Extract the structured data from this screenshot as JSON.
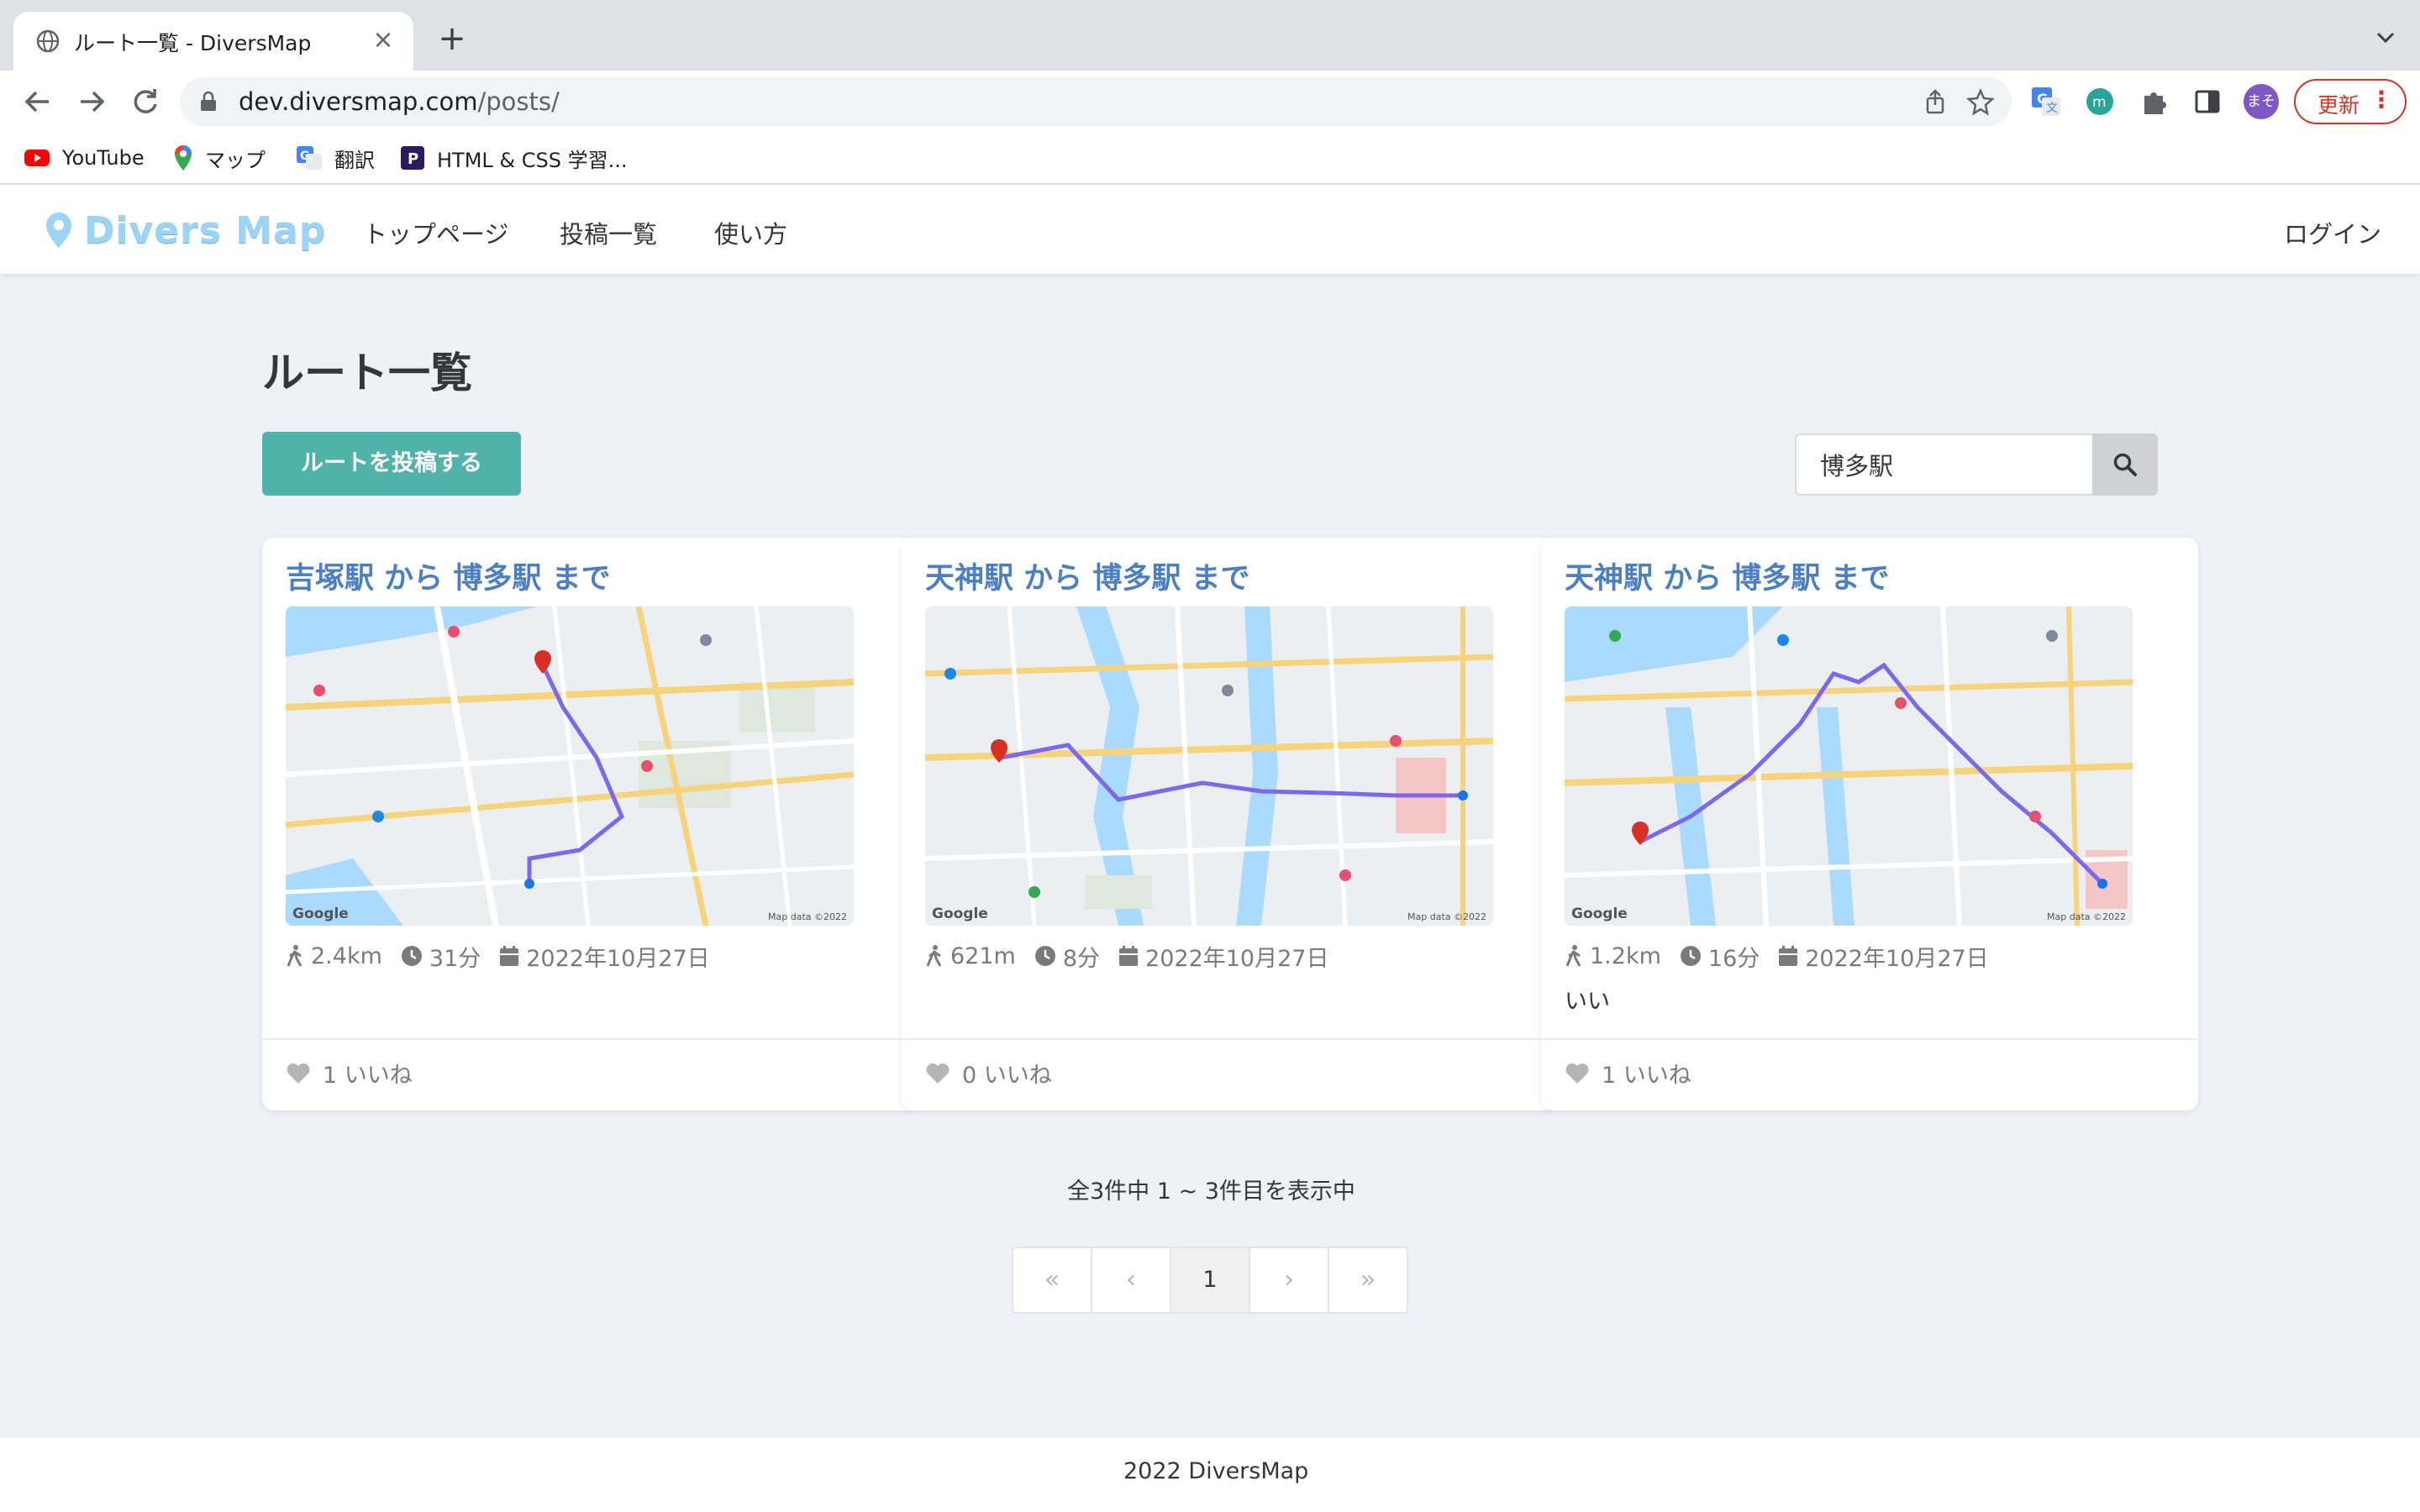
{
  "browser": {
    "tab_title": "ルート一覧 - DiversMap",
    "new_tab": "+",
    "url_host": "dev.diversmap.com",
    "url_path": "/posts/",
    "profile_initials": "まそ",
    "update_label": "更新",
    "bookmarks": [
      {
        "label": "YouTube",
        "icon": "youtube-icon"
      },
      {
        "label": "マップ",
        "icon": "maps-pin-icon"
      },
      {
        "label": "翻訳",
        "icon": "translate-icon"
      },
      {
        "label": "HTML & CSS 学習...",
        "icon": "progate-icon"
      }
    ]
  },
  "site": {
    "logo": "Divers Map",
    "nav": [
      "トップページ",
      "投稿一覧",
      "使い方"
    ],
    "login": "ログイン"
  },
  "page": {
    "title": "ルート一覧",
    "post_button": "ルートを投稿する",
    "search_value": "博多駅",
    "count_text": "全3件中 1 ~ 3件目を表示中",
    "pagination": [
      "«",
      "‹",
      "1",
      "›",
      "»"
    ],
    "footer": "2022 DiversMap"
  },
  "posts": [
    {
      "title": "吉塚駅 から 博多駅 まで",
      "distance": "2.4km",
      "duration": "31分",
      "date": "2022年10月27日",
      "comment": "",
      "likes": "1 いいね",
      "map": {
        "google": "Google",
        "data": "Map data ©2022"
      }
    },
    {
      "title": "天神駅 から 博多駅 まで",
      "distance": "621m",
      "duration": "8分",
      "date": "2022年10月27日",
      "comment": "",
      "likes": "0 いいね",
      "map": {
        "google": "Google",
        "data": "Map data ©2022"
      }
    },
    {
      "title": "天神駅 から 博多駅 まで",
      "distance": "1.2km",
      "duration": "16分",
      "date": "2022年10月27日",
      "comment": "いい",
      "likes": "1 いいね",
      "map": {
        "google": "Google",
        "data": "Map data ©2022"
      }
    }
  ],
  "colors": {
    "accent": "#4fb3a9",
    "title_blue": "#4a7fc1",
    "route": "#7b68ee",
    "update_red": "#d93025"
  }
}
